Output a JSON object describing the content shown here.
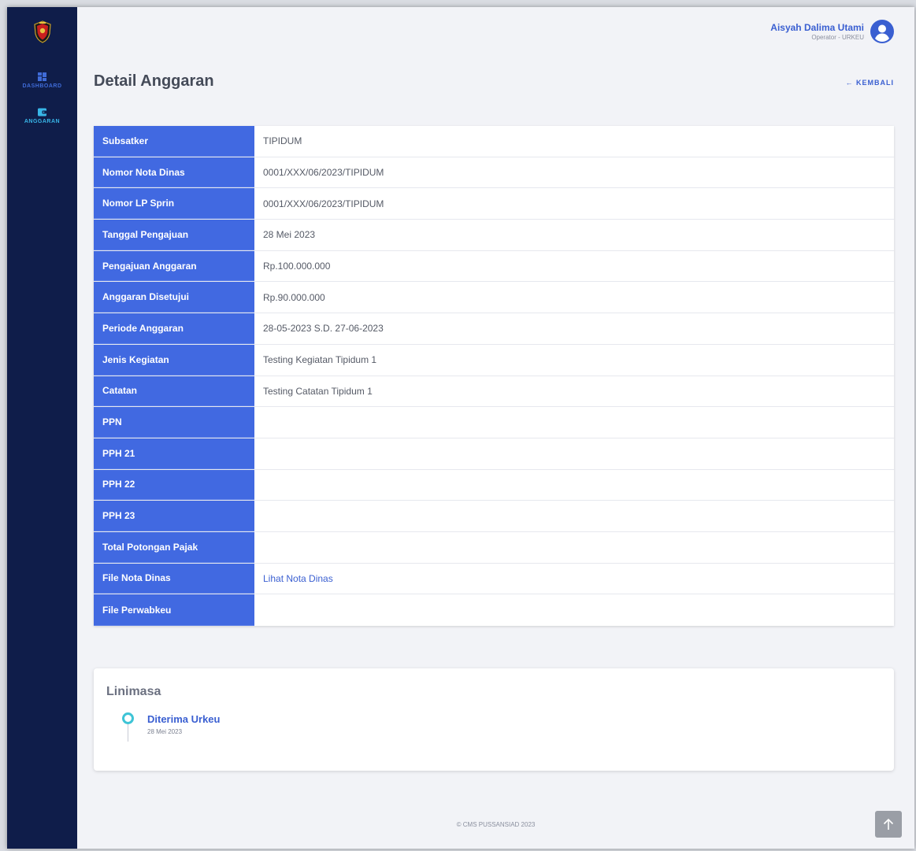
{
  "sidebar": {
    "items": [
      {
        "label": "DASHBOARD",
        "icon": "grid-icon"
      },
      {
        "label": "ANGGARAN",
        "icon": "wallet-icon"
      }
    ]
  },
  "user": {
    "name": "Aisyah Dalima Utami",
    "role": "Operator - URKEU"
  },
  "page": {
    "title": "Detail Anggaran",
    "back_label": "← KEMBALI"
  },
  "details": [
    {
      "label": "Subsatker",
      "value": "TIPIDUM"
    },
    {
      "label": "Nomor Nota Dinas",
      "value": "0001/XXX/06/2023/TIPIDUM"
    },
    {
      "label": "Nomor LP Sprin",
      "value": "0001/XXX/06/2023/TIPIDUM"
    },
    {
      "label": "Tanggal Pengajuan",
      "value": "28 Mei 2023"
    },
    {
      "label": "Pengajuan Anggaran",
      "value": "Rp.100.000.000"
    },
    {
      "label": "Anggaran Disetujui",
      "value": "Rp.90.000.000"
    },
    {
      "label": "Periode Anggaran",
      "value": "28-05-2023 S.D. 27-06-2023"
    },
    {
      "label": "Jenis Kegiatan",
      "value": "Testing Kegiatan Tipidum 1"
    },
    {
      "label": "Catatan",
      "value": "Testing Catatan Tipidum 1"
    },
    {
      "label": "PPN",
      "value": ""
    },
    {
      "label": "PPH 21",
      "value": ""
    },
    {
      "label": "PPH 22",
      "value": ""
    },
    {
      "label": "PPH 23",
      "value": ""
    },
    {
      "label": "Total Potongan Pajak",
      "value": ""
    },
    {
      "label": "File Nota Dinas",
      "value": "Lihat Nota Dinas"
    },
    {
      "label": "File Perwabkeu",
      "value": ""
    }
  ],
  "timeline": {
    "title": "Linimasa",
    "items": [
      {
        "title": "Diterima Urkeu",
        "date": "28 Mei 2023"
      }
    ]
  },
  "footer": {
    "text": "© CMS PUSSANSIAD 2023"
  },
  "colors": {
    "sidebar_bg": "#0f1d4a",
    "label_bg": "#4169e1",
    "accent": "#3a5fd1",
    "timeline_dot": "#3ec4d6"
  }
}
